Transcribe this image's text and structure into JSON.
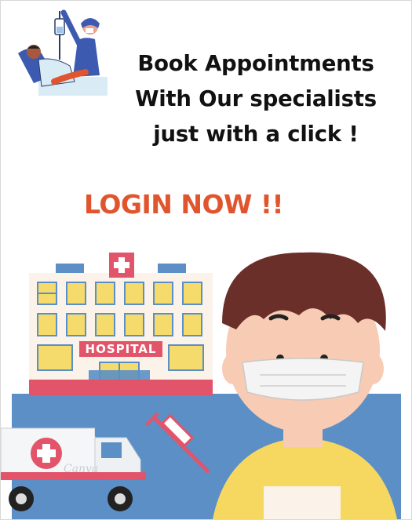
{
  "headline": {
    "line1": "Book Appointments",
    "line2": "With Our specialists",
    "line3": "just with a click !"
  },
  "cta": {
    "label": "LOGIN NOW !!"
  },
  "illustration": {
    "hospital_sign": "HOSPITAL",
    "watermark": "Canva"
  },
  "colors": {
    "accent": "#e0552e",
    "hospital_red": "#e2546a",
    "sky_blue": "#5b8fc5",
    "window_yellow": "#f5da6c",
    "hair_brown": "#6b2f2a",
    "shirt_yellow": "#f6d860"
  }
}
